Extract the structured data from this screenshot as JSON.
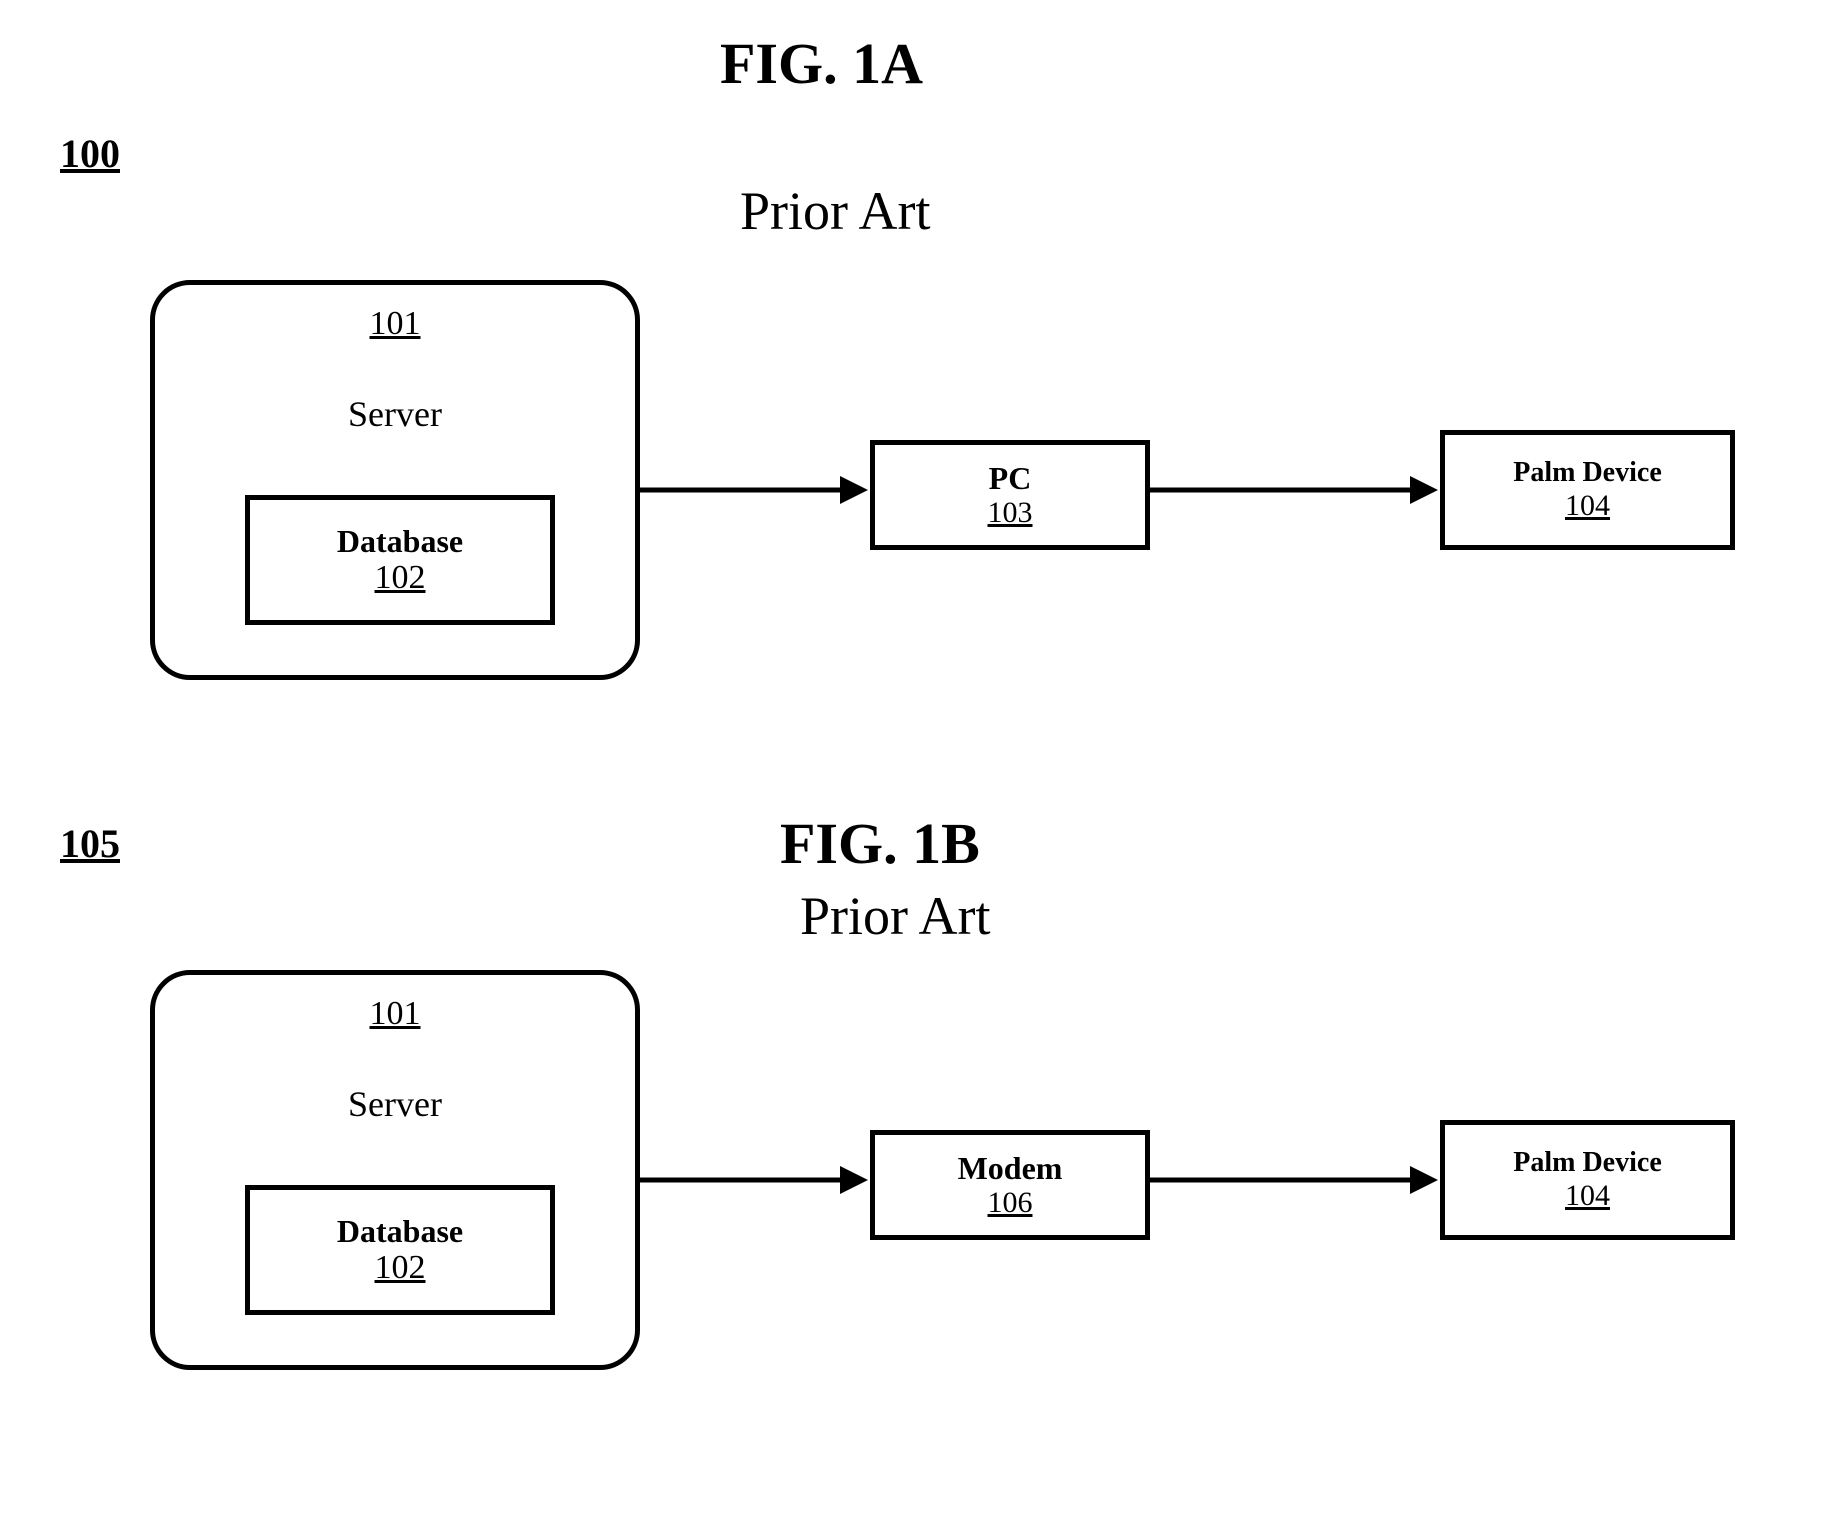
{
  "figA": {
    "title": "FIG. 1A",
    "subtitle": "Prior Art",
    "ref": "100",
    "server": {
      "ref": "101",
      "label": "Server"
    },
    "database": {
      "label": "Database",
      "ref": "102"
    },
    "middle": {
      "label": "PC",
      "ref": "103"
    },
    "device": {
      "label": "Palm Device",
      "ref": "104"
    }
  },
  "figB": {
    "title": "FIG. 1B",
    "subtitle": "Prior Art",
    "ref": "105",
    "server": {
      "ref": "101",
      "label": "Server"
    },
    "database": {
      "label": "Database",
      "ref": "102"
    },
    "middle": {
      "label": "Modem",
      "ref": "106"
    },
    "device": {
      "label": "Palm Device",
      "ref": "104"
    }
  }
}
